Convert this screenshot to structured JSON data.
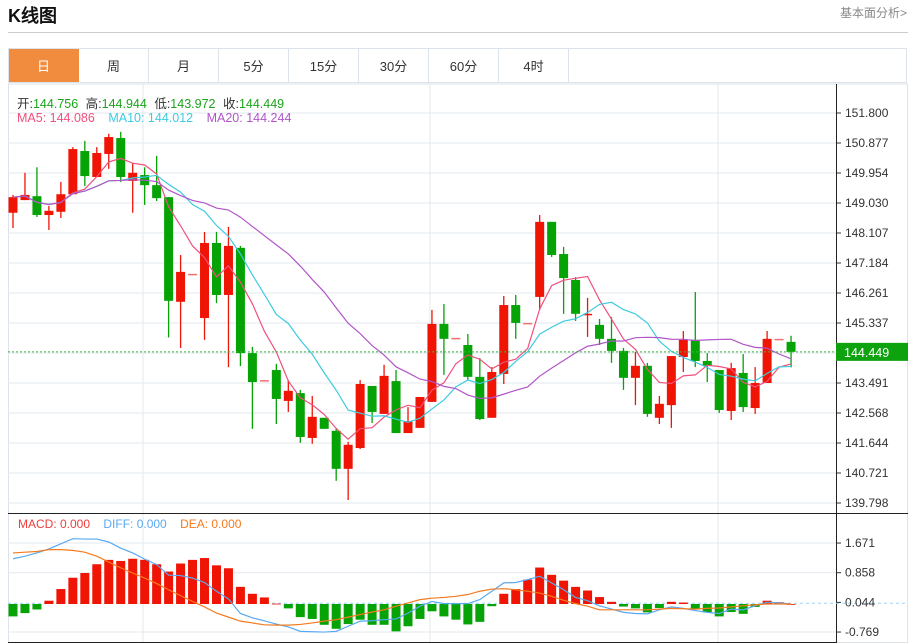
{
  "header": {
    "title": "K线图",
    "link": "基本面分析>"
  },
  "tabs": [
    {
      "label": "日",
      "active": true
    },
    {
      "label": "周"
    },
    {
      "label": "月"
    },
    {
      "label": "5分"
    },
    {
      "label": "15分"
    },
    {
      "label": "30分"
    },
    {
      "label": "60分"
    },
    {
      "label": "4时"
    }
  ],
  "ohlc_legend": {
    "open_label": "开:",
    "open": "144.756",
    "high_label": "高:",
    "high": "144.944",
    "low_label": "低:",
    "low": "143.972",
    "close_label": "收:",
    "close": "144.449"
  },
  "ma_legend": {
    "ma5": "MA5: 144.086",
    "ma10": "MA10: 144.012",
    "ma20": "MA20: 144.244"
  },
  "macd_legend": {
    "macd": "MACD: 0.000",
    "diff": "DIFF: 0.000",
    "dea": "DEA: 0.000"
  },
  "current_price": "144.449",
  "colors": {
    "up": "#f01405",
    "down": "#05a305",
    "ma5": "#f0507d",
    "ma10": "#3ccbe0",
    "ma20": "#b155c8",
    "diff": "#5aa9f0",
    "dea": "#f57a1e",
    "active_tab": "#f18c3f"
  },
  "chart_data": {
    "type": "candlestick",
    "price_axis_ticks": [
      "151.800",
      "150.877",
      "149.954",
      "149.030",
      "148.107",
      "147.184",
      "146.261",
      "145.337",
      "143.491",
      "142.568",
      "141.644",
      "140.721",
      "139.798"
    ],
    "price_range": [
      139.798,
      151.8
    ],
    "macd_axis_ticks": [
      "1.671",
      "0.858",
      "0.044",
      "-0.769"
    ],
    "macd_range": [
      -0.769,
      1.671
    ],
    "ohlc": [
      [
        148.73,
        149.28,
        148.26,
        149.21
      ],
      [
        149.12,
        149.96,
        149.12,
        149.28
      ],
      [
        149.24,
        150.13,
        148.6,
        148.66
      ],
      [
        148.66,
        148.94,
        148.2,
        148.79
      ],
      [
        148.76,
        149.68,
        148.57,
        149.3
      ],
      [
        149.3,
        150.75,
        149.3,
        150.69
      ],
      [
        150.63,
        150.94,
        149.55,
        149.86
      ],
      [
        149.83,
        150.75,
        149.83,
        150.57
      ],
      [
        150.54,
        151.16,
        150.08,
        151.06
      ],
      [
        151.03,
        151.22,
        149.68,
        149.83
      ],
      [
        149.71,
        150.26,
        148.73,
        149.96
      ],
      [
        149.89,
        150.13,
        148.97,
        149.58
      ],
      [
        149.58,
        150.48,
        149.09,
        149.18
      ],
      [
        149.21,
        149.21,
        144.89,
        146.02
      ],
      [
        145.99,
        147.43,
        144.57,
        146.91
      ],
      [
        146.85,
        146.85,
        146.85,
        146.85
      ],
      [
        145.49,
        148.14,
        144.82,
        147.8
      ],
      [
        147.8,
        148.14,
        145.95,
        146.2
      ],
      [
        146.2,
        148.29,
        143.98,
        147.71
      ],
      [
        147.65,
        147.71,
        144.01,
        144.41
      ],
      [
        144.41,
        144.6,
        142.08,
        143.52
      ],
      [
        143.58,
        143.58,
        143.58,
        143.58
      ],
      [
        143.89,
        144.08,
        142.23,
        143.0
      ],
      [
        142.94,
        143.58,
        142.6,
        143.25
      ],
      [
        143.18,
        143.28,
        141.65,
        141.83
      ],
      [
        141.8,
        143.09,
        141.62,
        142.45
      ],
      [
        142.42,
        142.42,
        142.08,
        142.08
      ],
      [
        142.02,
        142.11,
        140.48,
        140.85
      ],
      [
        140.85,
        141.68,
        139.89,
        141.59
      ],
      [
        141.49,
        143.58,
        141.46,
        143.46
      ],
      [
        143.4,
        143.4,
        142.26,
        142.6
      ],
      [
        142.54,
        144.05,
        142.54,
        143.71
      ],
      [
        143.55,
        143.89,
        141.95,
        141.95
      ],
      [
        141.95,
        142.75,
        141.95,
        142.32
      ],
      [
        142.11,
        143.06,
        142.11,
        143.06
      ],
      [
        142.91,
        145.74,
        142.91,
        145.31
      ],
      [
        145.31,
        145.92,
        143.74,
        144.85
      ],
      [
        144.88,
        144.88,
        144.88,
        144.88
      ],
      [
        144.66,
        145.0,
        143.58,
        143.68
      ],
      [
        143.68,
        144.26,
        142.35,
        142.38
      ],
      [
        142.42,
        143.98,
        142.42,
        143.83
      ],
      [
        143.77,
        146.17,
        143.46,
        145.89
      ],
      [
        145.89,
        146.2,
        144.85,
        145.34
      ],
      [
        145.34,
        145.34,
        145.34,
        145.34
      ],
      [
        146.14,
        148.66,
        145.74,
        148.45
      ],
      [
        148.45,
        148.45,
        147.37,
        147.43
      ],
      [
        147.46,
        147.68,
        145.62,
        146.72
      ],
      [
        146.66,
        146.75,
        145.4,
        145.62
      ],
      [
        145.62,
        146.11,
        144.91,
        145.62
      ],
      [
        145.28,
        145.46,
        144.66,
        144.85
      ],
      [
        144.85,
        145.52,
        144.11,
        144.48
      ],
      [
        144.48,
        144.57,
        143.28,
        143.65
      ],
      [
        143.65,
        144.45,
        142.81,
        144.02
      ],
      [
        144.02,
        144.11,
        142.45,
        142.54
      ],
      [
        142.42,
        143.09,
        142.23,
        142.85
      ],
      [
        142.81,
        144.32,
        142.11,
        144.32
      ],
      [
        144.29,
        145.09,
        143.83,
        144.82
      ],
      [
        144.82,
        146.29,
        143.98,
        144.17
      ],
      [
        144.17,
        144.41,
        143.52,
        144.02
      ],
      [
        143.89,
        143.89,
        142.57,
        142.66
      ],
      [
        142.63,
        144.11,
        142.35,
        143.95
      ],
      [
        143.8,
        144.38,
        142.6,
        142.75
      ],
      [
        142.72,
        143.98,
        142.54,
        143.49
      ],
      [
        143.49,
        145.09,
        143.49,
        144.85
      ],
      [
        144.85,
        144.85,
        144.85,
        144.85
      ],
      [
        144.756,
        144.944,
        143.972,
        144.449
      ]
    ],
    "macd_hist": [
      -0.34,
      -0.25,
      -0.15,
      0.09,
      0.41,
      0.72,
      0.85,
      1.09,
      1.21,
      1.18,
      1.24,
      1.21,
      1.09,
      0.89,
      1.11,
      1.21,
      1.26,
      1.06,
      0.98,
      0.47,
      0.28,
      0.18,
      0.01,
      -0.12,
      -0.36,
      -0.41,
      -0.57,
      -0.68,
      -0.55,
      -0.43,
      -0.57,
      -0.57,
      -0.75,
      -0.61,
      -0.41,
      -0.2,
      -0.34,
      -0.43,
      -0.56,
      -0.49,
      -0.06,
      0.28,
      0.41,
      0.67,
      1.0,
      0.8,
      0.64,
      0.47,
      0.37,
      0.19,
      0.06,
      -0.07,
      -0.12,
      -0.23,
      -0.11,
      0.06,
      0.04,
      -0.13,
      -0.23,
      -0.34,
      -0.22,
      -0.27,
      -0.08,
      0.09,
      0.05,
      0.0
    ],
    "diff": [
      1.24,
      1.31,
      1.4,
      1.51,
      1.65,
      1.79,
      1.78,
      1.78,
      1.7,
      1.53,
      1.4,
      1.23,
      1.08,
      0.79,
      0.78,
      0.71,
      0.59,
      0.35,
      0.14,
      -0.26,
      -0.38,
      -0.46,
      -0.55,
      -0.63,
      -0.75,
      -0.76,
      -0.77,
      -0.75,
      -0.61,
      -0.47,
      -0.46,
      -0.43,
      -0.41,
      -0.25,
      -0.06,
      0.07,
      0.01,
      0.01,
      0.01,
      0.12,
      0.35,
      0.58,
      0.59,
      0.67,
      0.76,
      0.58,
      0.39,
      0.18,
      0.09,
      -0.05,
      -0.14,
      -0.23,
      -0.26,
      -0.27,
      -0.16,
      -0.08,
      -0.12,
      -0.18,
      -0.23,
      -0.26,
      -0.14,
      -0.16,
      -0.05,
      0.05,
      0.03,
      0.0
    ],
    "dea": [
      1.4,
      1.42,
      1.44,
      1.49,
      1.49,
      1.47,
      1.42,
      1.31,
      1.15,
      0.99,
      0.85,
      0.71,
      0.56,
      0.39,
      0.23,
      0.07,
      -0.08,
      -0.25,
      -0.36,
      -0.47,
      -0.52,
      -0.57,
      -0.58,
      -0.58,
      -0.56,
      -0.52,
      -0.47,
      -0.43,
      -0.36,
      -0.29,
      -0.22,
      -0.16,
      -0.06,
      0.03,
      0.12,
      0.16,
      0.18,
      0.21,
      0.26,
      0.35,
      0.41,
      0.42,
      0.39,
      0.35,
      0.3,
      0.21,
      0.1,
      0.01,
      -0.06,
      -0.16,
      -0.16,
      -0.16,
      -0.16,
      -0.16,
      -0.14,
      -0.12,
      -0.13,
      -0.14,
      -0.12,
      -0.11,
      -0.08,
      -0.05,
      -0.02,
      0.0,
      0.0,
      0.0
    ]
  }
}
